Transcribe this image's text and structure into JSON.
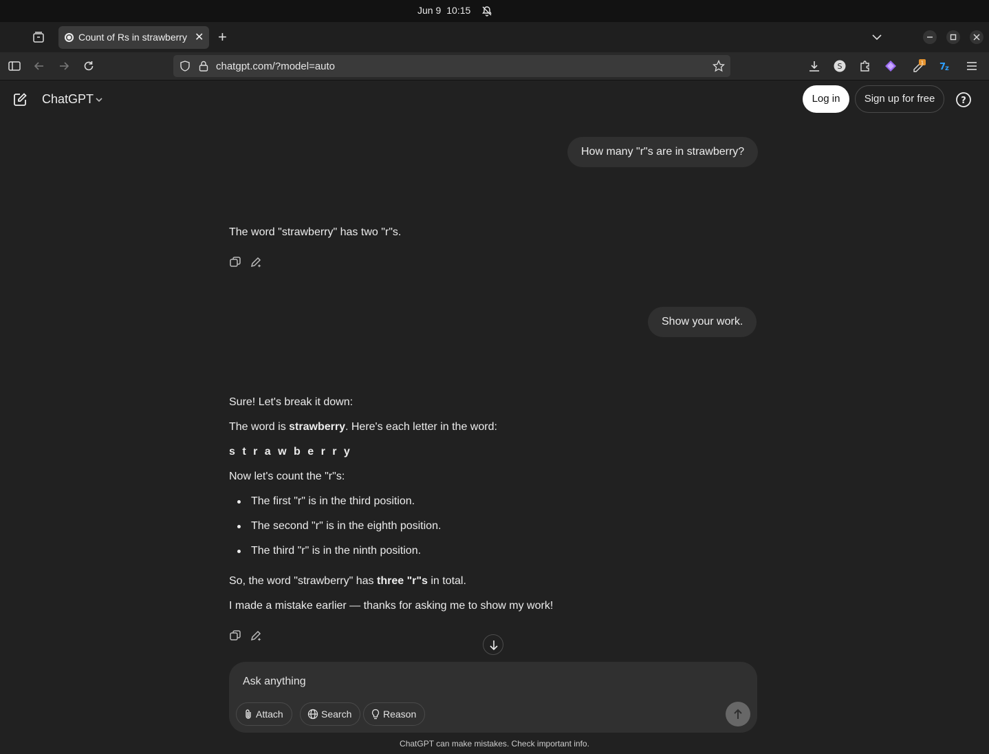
{
  "os": {
    "date": "Jun 9",
    "time": "10:15"
  },
  "browser": {
    "tab_title": "Count of Rs in strawberry",
    "url": "chatgpt.com/?model=auto",
    "extension_badge": "1"
  },
  "header": {
    "brand": "ChatGPT",
    "login_label": "Log in",
    "signup_label": "Sign up for free"
  },
  "conversation": {
    "user_1": "How many \"r\"s are in strawberry?",
    "assistant_1": "The word \"strawberry\" has two \"r\"s.",
    "user_2": "Show your work.",
    "assistant_2": {
      "intro": "Sure! Let's break it down:",
      "word_pre": "The word is ",
      "word_bold": "strawberry",
      "word_post": ". Here's each letter in the word:",
      "letters": "s t r a w b e r r y",
      "count_intro": "Now let's count the \"r\"s:",
      "bullets": [
        "The first \"r\" is in the third position.",
        "The second \"r\" is in the eighth position.",
        "The third \"r\" is in the ninth position."
      ],
      "summary_pre": "So, the word \"strawberry\" has ",
      "summary_bold": "three \"r\"s",
      "summary_post": " in total.",
      "closing": "I made a mistake earlier — thanks for asking me to show my work!"
    }
  },
  "composer": {
    "placeholder": "Ask anything",
    "attach_label": "Attach",
    "search_label": "Search",
    "reason_label": "Reason"
  },
  "disclaimer": "ChatGPT can make mistakes. Check important info."
}
